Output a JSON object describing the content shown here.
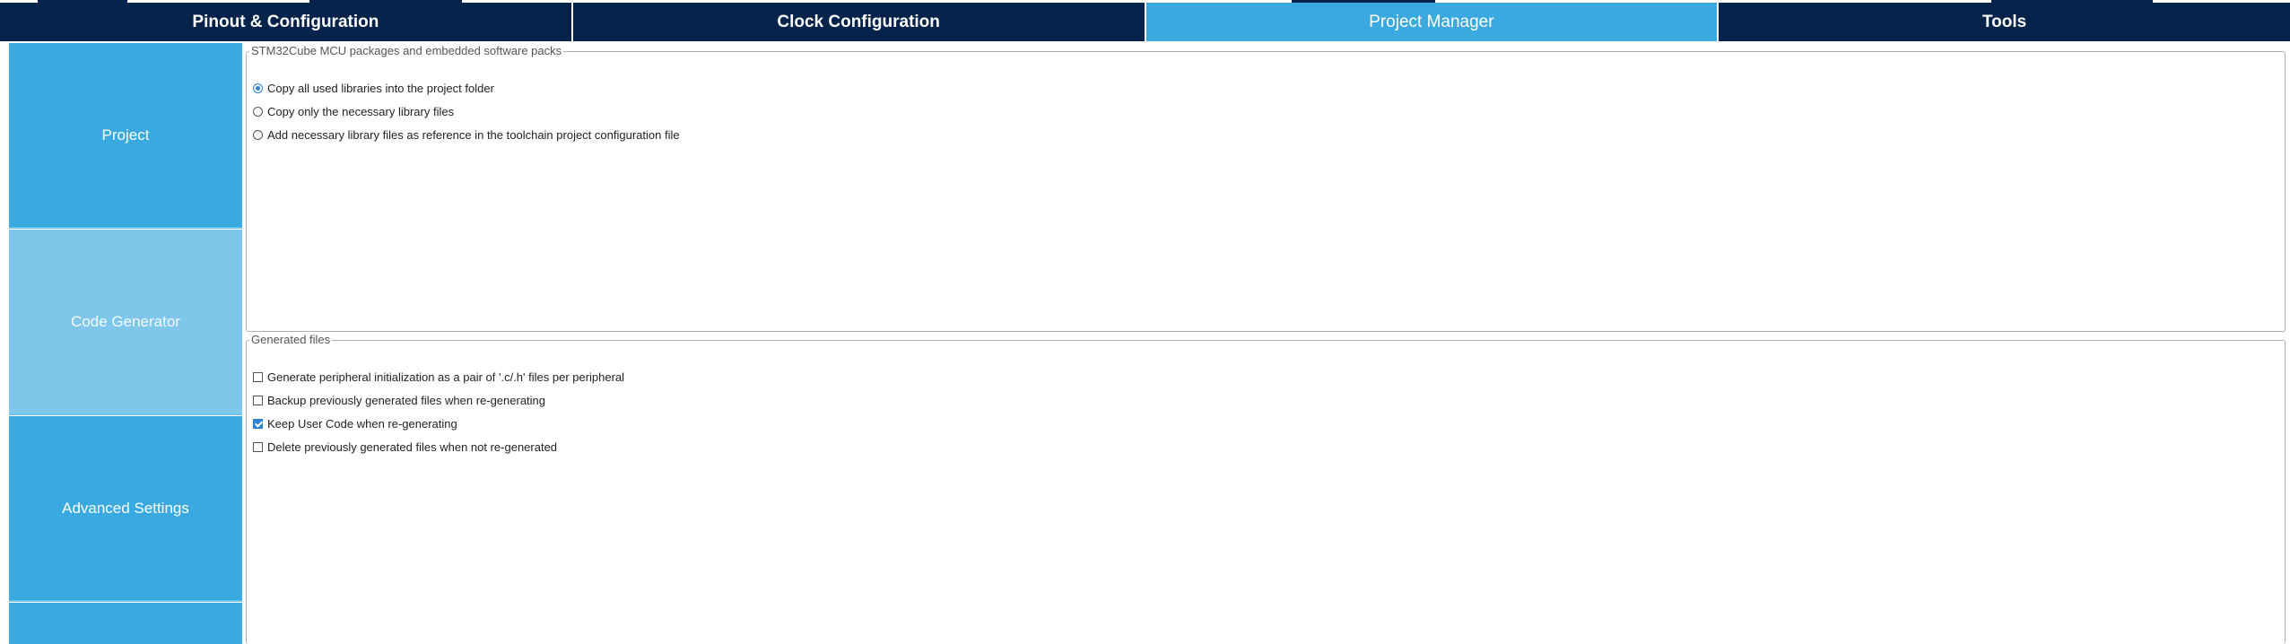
{
  "tabs": [
    {
      "label": "Pinout & Configuration",
      "active": false
    },
    {
      "label": "Clock Configuration",
      "active": false
    },
    {
      "label": "Project Manager",
      "active": true
    },
    {
      "label": "Tools",
      "active": false
    }
  ],
  "sidebar": {
    "items": [
      {
        "label": "Project",
        "active": false
      },
      {
        "label": "Code Generator",
        "active": true
      },
      {
        "label": "Advanced Settings",
        "active": false
      },
      {
        "label": "",
        "active": false
      }
    ]
  },
  "packs_group": {
    "legend": "STM32Cube MCU packages and embedded software packs",
    "options": [
      {
        "label": "Copy all used libraries into the project folder",
        "selected": true
      },
      {
        "label": "Copy only the necessary library files",
        "selected": false
      },
      {
        "label": "Add necessary library files as reference in the toolchain project configuration file",
        "selected": false
      }
    ]
  },
  "generated_group": {
    "legend": "Generated files",
    "options": [
      {
        "label": "Generate peripheral initialization as a pair of '.c/.h' files per peripheral",
        "checked": false
      },
      {
        "label": "Backup previously generated files when re-generating",
        "checked": false
      },
      {
        "label": "Keep User Code when re-generating",
        "checked": true
      },
      {
        "label": "Delete previously generated files when not re-generated",
        "checked": false
      }
    ]
  },
  "colors": {
    "nav_dark": "#03234b",
    "accent": "#3aa9df",
    "sidebar_active": "#7ec7ea",
    "check_blue": "#2b83d6"
  }
}
